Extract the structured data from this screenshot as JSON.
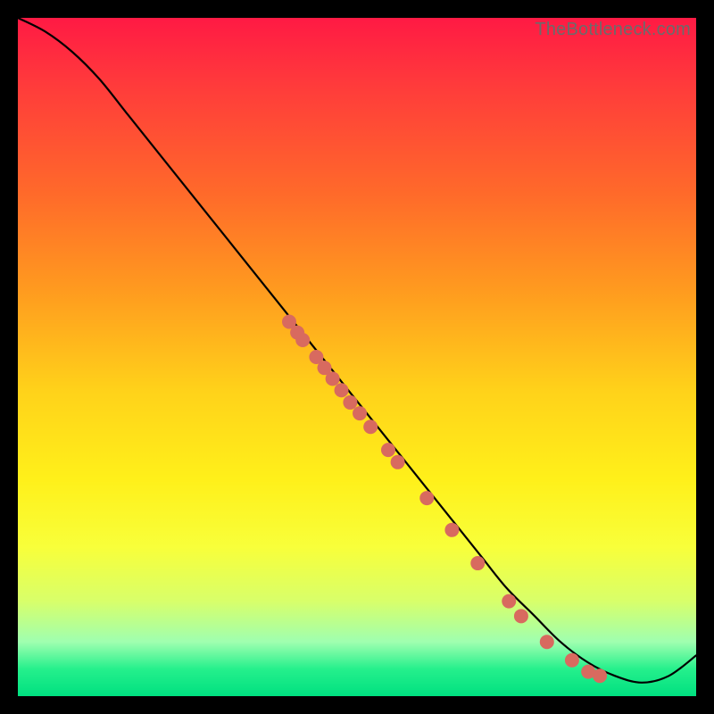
{
  "attribution": "TheBottleneck.com",
  "chart_data": {
    "type": "line",
    "title": "",
    "xlabel": "",
    "ylabel": "",
    "xlim": [
      0,
      100
    ],
    "ylim": [
      0,
      100
    ],
    "grid": false,
    "legend": false,
    "series": [
      {
        "name": "curve",
        "x": [
          0,
          4,
          8,
          12,
          16,
          20,
          24,
          28,
          32,
          36,
          40,
          44,
          48,
          52,
          56,
          60,
          64,
          68,
          72,
          76,
          80,
          84,
          88,
          92,
          96,
          100
        ],
        "y": [
          100,
          98,
          95,
          91,
          86,
          81,
          76,
          71,
          66,
          61,
          56,
          51,
          46,
          41,
          36,
          31,
          26,
          21,
          16,
          12,
          8,
          5,
          3,
          2,
          3,
          6
        ]
      }
    ],
    "scatter": [
      {
        "x": 40.0,
        "y": 55.2
      },
      {
        "x": 41.2,
        "y": 53.6
      },
      {
        "x": 42.0,
        "y": 52.5
      },
      {
        "x": 44.0,
        "y": 50.0
      },
      {
        "x": 45.2,
        "y": 48.4
      },
      {
        "x": 46.4,
        "y": 46.8
      },
      {
        "x": 47.7,
        "y": 45.1
      },
      {
        "x": 49.0,
        "y": 43.3
      },
      {
        "x": 50.4,
        "y": 41.7
      },
      {
        "x": 52.0,
        "y": 39.7
      },
      {
        "x": 54.6,
        "y": 36.3
      },
      {
        "x": 56.0,
        "y": 34.5
      },
      {
        "x": 60.3,
        "y": 29.2
      },
      {
        "x": 64.0,
        "y": 24.5
      },
      {
        "x": 67.8,
        "y": 19.6
      },
      {
        "x": 72.4,
        "y": 14.0
      },
      {
        "x": 74.2,
        "y": 11.8
      },
      {
        "x": 78.0,
        "y": 8.0
      },
      {
        "x": 81.7,
        "y": 5.3
      },
      {
        "x": 84.1,
        "y": 3.6
      },
      {
        "x": 85.8,
        "y": 3.0
      }
    ],
    "background_gradient": {
      "top": "#ff1a44",
      "mid": "#fff01a",
      "bottom": "#00e080"
    }
  }
}
